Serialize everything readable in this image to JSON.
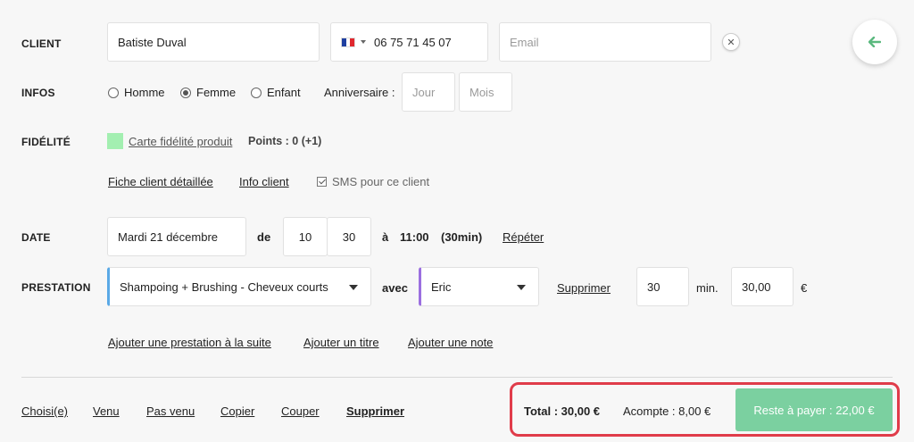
{
  "client": {
    "label": "CLIENT",
    "name_value": "Batiste Duval",
    "phone_value": "06 75 71 45 07",
    "email_placeholder": "Email"
  },
  "infos": {
    "label": "INFOS",
    "radios": [
      {
        "label": "Homme",
        "selected": false
      },
      {
        "label": "Femme",
        "selected": true
      },
      {
        "label": "Enfant",
        "selected": false
      }
    ],
    "birthday_label": "Anniversaire :",
    "day_placeholder": "Jour",
    "month_placeholder": "Mois"
  },
  "fidelite": {
    "label": "FIDÉLITÉ",
    "card_color": "#a3efb1",
    "card_link": "Carte fidélité produit",
    "points": "Points : 0 (+1)"
  },
  "links": {
    "fiche": "Fiche client détaillée",
    "info": "Info client",
    "sms": "SMS pour ce client"
  },
  "date": {
    "label": "DATE",
    "value": "Mardi 21 décembre",
    "de": "de",
    "hour": "10",
    "minute": "30",
    "a": "à",
    "end_time": "11:00",
    "duration": "(30min)",
    "repeat": "Répéter"
  },
  "prestation": {
    "label": "PRESTATION",
    "service": "Shampoing + Brushing - Cheveux courts",
    "service_accent": "#5aa9e6",
    "avec": "avec",
    "staff": "Eric",
    "staff_accent": "#9b6fe0",
    "delete": "Supprimer",
    "minutes": "30",
    "min_unit": "min.",
    "price": "30,00",
    "currency": "€"
  },
  "add_links": {
    "suite": "Ajouter une prestation à la suite",
    "titre": "Ajouter un titre",
    "note": "Ajouter une note"
  },
  "footer": {
    "actions": [
      "Choisi(e)",
      "Venu",
      "Pas venu",
      "Copier",
      "Couper",
      "Supprimer"
    ],
    "total": "Total : 30,00 €",
    "acompte": "Acompte : 8,00 €",
    "pay_button": "Reste à payer : 22,00 €",
    "pay_color": "#7bd0a0",
    "highlight_color": "#e03c4a"
  },
  "icons": {
    "back": "arrow-left-icon",
    "clear": "close-icon",
    "flag": "france-flag-icon"
  }
}
